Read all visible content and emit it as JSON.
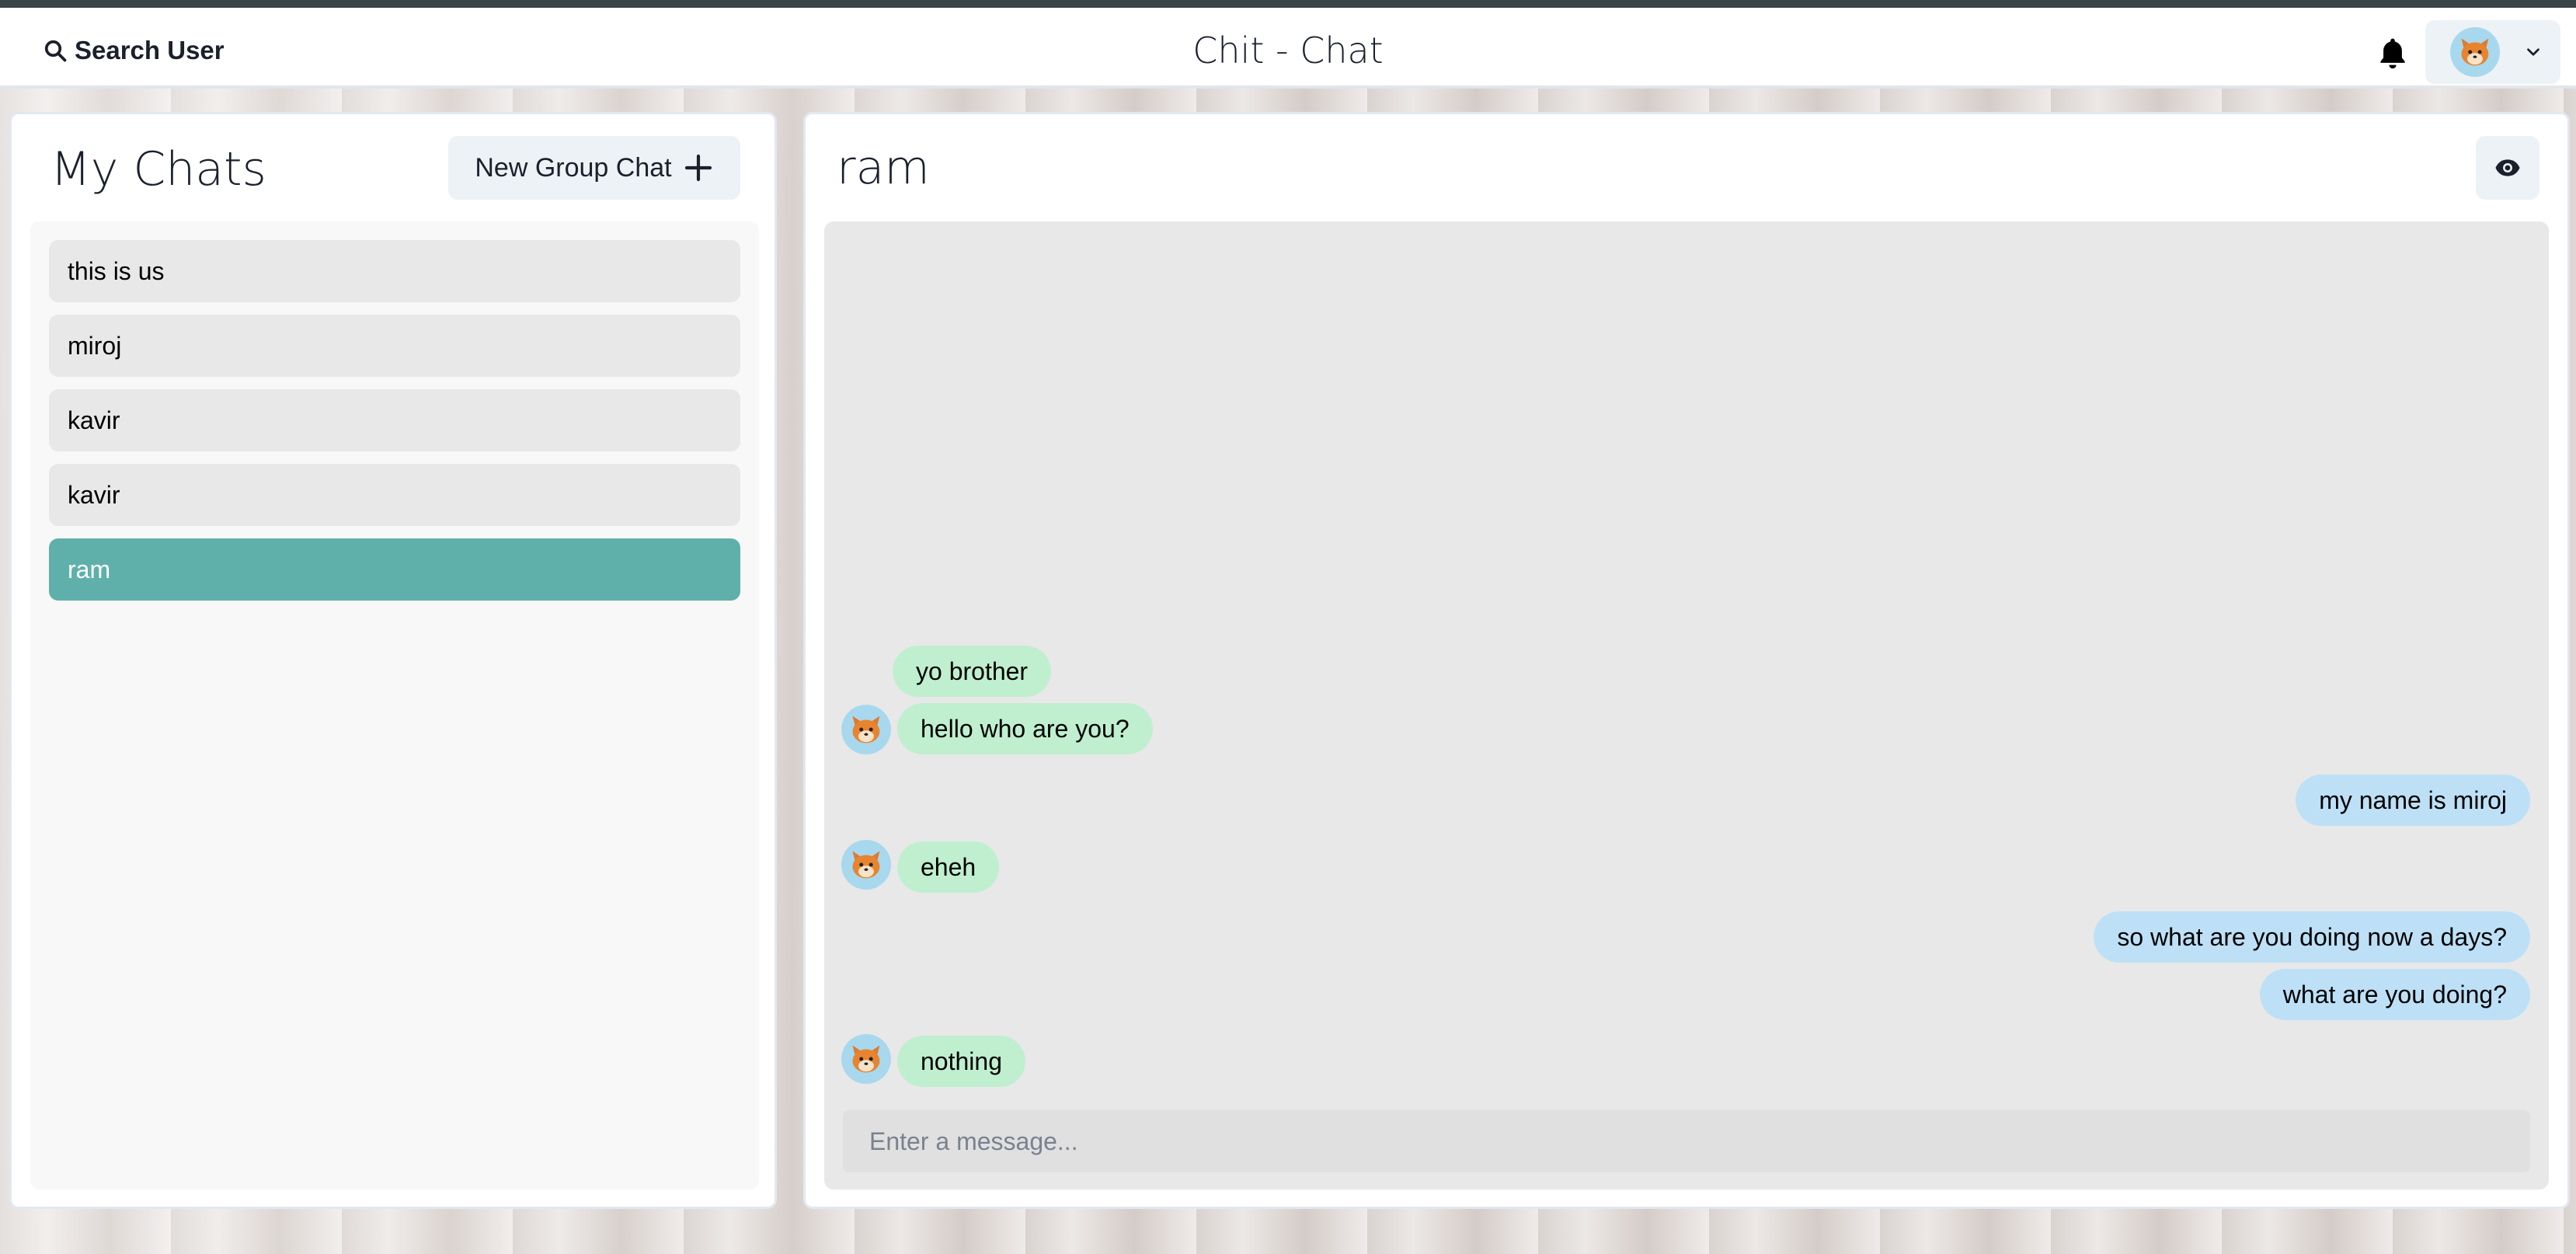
{
  "header": {
    "search_label": "Search User",
    "app_title": "Chit - Chat",
    "icons": {
      "search": "search-icon",
      "notifications": "bell-icon",
      "profile_menu": "chevron-down-icon"
    }
  },
  "sidebar": {
    "title": "My Chats",
    "new_group_label": "New Group Chat",
    "new_group_icon": "plus-icon",
    "chats": [
      {
        "name": "this is us",
        "active": false
      },
      {
        "name": "miroj",
        "active": false
      },
      {
        "name": "kavir",
        "active": false
      },
      {
        "name": "kavir",
        "active": false
      },
      {
        "name": "ram",
        "active": true
      }
    ]
  },
  "chat": {
    "name": "ram",
    "view_profile_icon": "eye-icon",
    "messages": [
      {
        "text": "yo brother",
        "direction": "incoming",
        "show_avatar": false
      },
      {
        "text": "hello who are you?",
        "direction": "incoming",
        "show_avatar": true
      },
      {
        "text": "my name is miroj",
        "direction": "outgoing",
        "show_avatar": false
      },
      {
        "text": "eheh",
        "direction": "incoming",
        "show_avatar": true
      },
      {
        "text": "so what are you doing now a days?",
        "direction": "outgoing",
        "show_avatar": false
      },
      {
        "text": "what are you doing?",
        "direction": "outgoing",
        "show_avatar": false
      },
      {
        "text": "nothing",
        "direction": "incoming",
        "show_avatar": true
      }
    ],
    "input_placeholder": "Enter a message..."
  },
  "colors": {
    "active_chat": "#5fb0aa",
    "incoming_bubble": "#bfefcf",
    "outgoing_bubble": "#bde0f6",
    "panel_bg": "#ffffff",
    "messages_bg": "#e8e8e8"
  }
}
